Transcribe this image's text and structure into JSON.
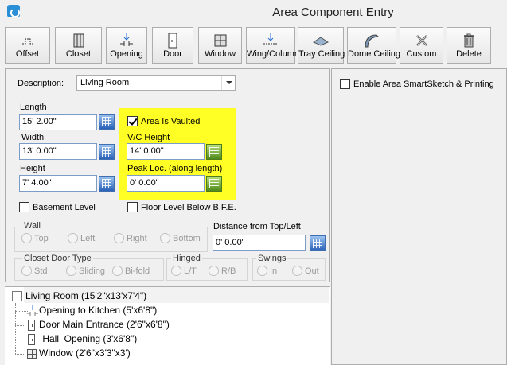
{
  "window": {
    "title": "Area Component Entry"
  },
  "toolbar": {
    "buttons": [
      {
        "label": "Offset",
        "icon": "offset-icon"
      },
      {
        "label": "Closet",
        "icon": "closet-icon"
      },
      {
        "label": "Opening",
        "icon": "opening-icon"
      },
      {
        "label": "Door",
        "icon": "door-icon"
      },
      {
        "label": "Window",
        "icon": "window-icon"
      },
      {
        "label": "Wing/Column",
        "icon": "wing-column-icon"
      },
      {
        "label": "Tray Ceiling",
        "icon": "tray-ceiling-icon"
      },
      {
        "label": "Dome Ceiling",
        "icon": "dome-ceiling-icon"
      },
      {
        "label": "Custom",
        "icon": "custom-icon"
      },
      {
        "label": "Delete",
        "icon": "trash-icon"
      }
    ]
  },
  "form": {
    "description_label": "Description:",
    "description_value": "Living Room",
    "length_label": "Length",
    "length_value": "15' 2.00\"",
    "width_label": "Width",
    "width_value": "13' 0.00\"",
    "height_label": "Height",
    "height_value": "7' 4.00\"",
    "vaulted_label": "Area Is Vaulted",
    "vaulted_checked": true,
    "vc_height_label": "V/C Height",
    "vc_height_value": "14' 0.00\"",
    "peak_label": "Peak Loc. (along length)",
    "peak_value": "0' 0.00\"",
    "basement_label": "Basement Level",
    "floor_level_label": "Floor Level  Below B.F.E.",
    "distance_label": "Distance from Top/Left",
    "distance_value": "0' 0.00\"",
    "highlight_color": "#ffff26"
  },
  "wall_group": {
    "title": "Wall",
    "options": [
      "Top",
      "Left",
      "Right",
      "Bottom"
    ]
  },
  "closet_group": {
    "title": "Closet Door Type",
    "options": [
      "Std",
      "Sliding",
      "Bi-fold"
    ]
  },
  "hinged_group": {
    "title": "Hinged",
    "options": [
      "L/T",
      "R/B"
    ]
  },
  "swings_group": {
    "title": "Swings",
    "options": [
      "In",
      "Out"
    ]
  },
  "right_panel": {
    "smartsketch_label": "Enable Area SmartSketch & Printing"
  },
  "tree": {
    "root": "Living Room (15'2\"x13'x7'4\")",
    "items": [
      "Opening to Kitchen (5'x6'8\")",
      "Door Main Entrance (2'6\"x6'8\")",
      " Hall  Opening (3'x6'8\")",
      "Window (2'6\"x3'3\"x3')"
    ]
  }
}
